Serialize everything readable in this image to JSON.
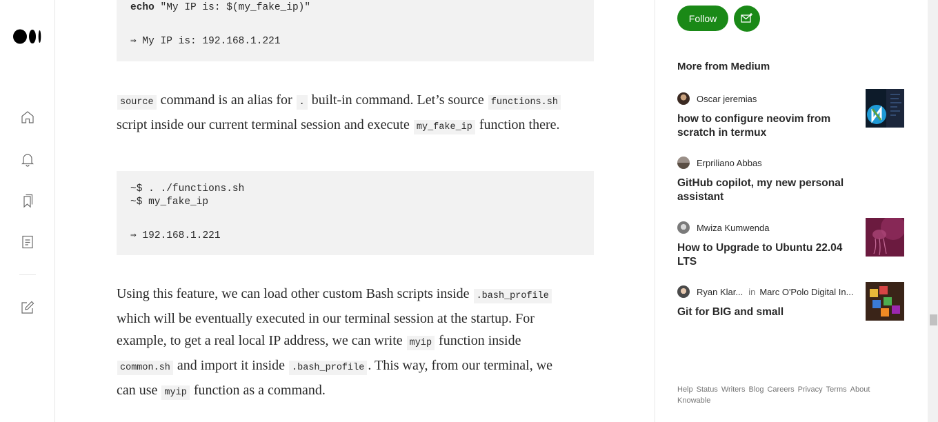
{
  "code_block_1": {
    "keyword": "echo",
    "command_rest": " \"My IP is: $(my_fake_ip)\"",
    "output": "⇒ My IP is: 192.168.1.221"
  },
  "para1": {
    "l1_code1": "source",
    "l1_t1": " command is an alias for ",
    "l1_code2": ".",
    "l1_t2": " built-in command. Let’s source ",
    "l1_code3": "functions.sh",
    "l2_t1": "script inside our current terminal session and execute ",
    "l2_code1": "my_fake_ip",
    "l2_t2": " function there."
  },
  "code_block_2": {
    "line1": "~$ . ./functions.sh",
    "line2": "~$ my_fake_ip",
    "output": "⇒ 192.168.1.221"
  },
  "para2": {
    "l1_t1": "Using this feature, we can load other custom Bash scripts inside ",
    "l1_code1": ".bash_profile",
    "l2_t1": "which will be eventually executed in our terminal session at the startup. For",
    "l3_t1": "example, to get a real local IP address, we can write ",
    "l3_code1": "myip",
    "l3_t2": " function inside",
    "l4_code1": "common.sh",
    "l4_t1": " and import it inside ",
    "l4_code2": ".bash_profile",
    "l4_t2": ". This way, from our terminal, we",
    "l5_t1": "can use ",
    "l5_code1": "myip",
    "l5_t2": " function as a command."
  },
  "sidebar": {
    "follow_label": "Follow",
    "more_title": "More from Medium",
    "stories": [
      {
        "author": "Oscar jeremias",
        "title": "how to configure neovim from scratch in termux",
        "thumb_icon": "neovim-logo-thumbnail"
      },
      {
        "author": "Erpriliano Abbas",
        "title": "GitHub copilot, my new personal assistant"
      },
      {
        "author": "Mwiza Kumwenda",
        "title": "How to Upgrade to Ubuntu 22.04 LTS",
        "thumb_icon": "ubuntu-jellyfish-thumbnail"
      },
      {
        "author": "Ryan Klar...",
        "in_word": "in",
        "publication": "Marc O'Polo Digital In...",
        "title": "Git for BIG and small",
        "thumb_icon": "colorful-blocks-thumbnail"
      }
    ],
    "footer": [
      "Help",
      "Status",
      "Writers",
      "Blog",
      "Careers",
      "Privacy",
      "Terms",
      "About",
      "Knowable"
    ]
  },
  "colors": {
    "accent": "#1a8917",
    "text": "#292929",
    "muted": "#757575",
    "code_bg": "#f2f2f2"
  },
  "icons": {
    "rail": [
      "medium-logo",
      "home-icon",
      "bell-icon",
      "bookmarks-icon",
      "stories-icon",
      "write-icon"
    ],
    "subscribe": "subscribe-mail-icon"
  }
}
